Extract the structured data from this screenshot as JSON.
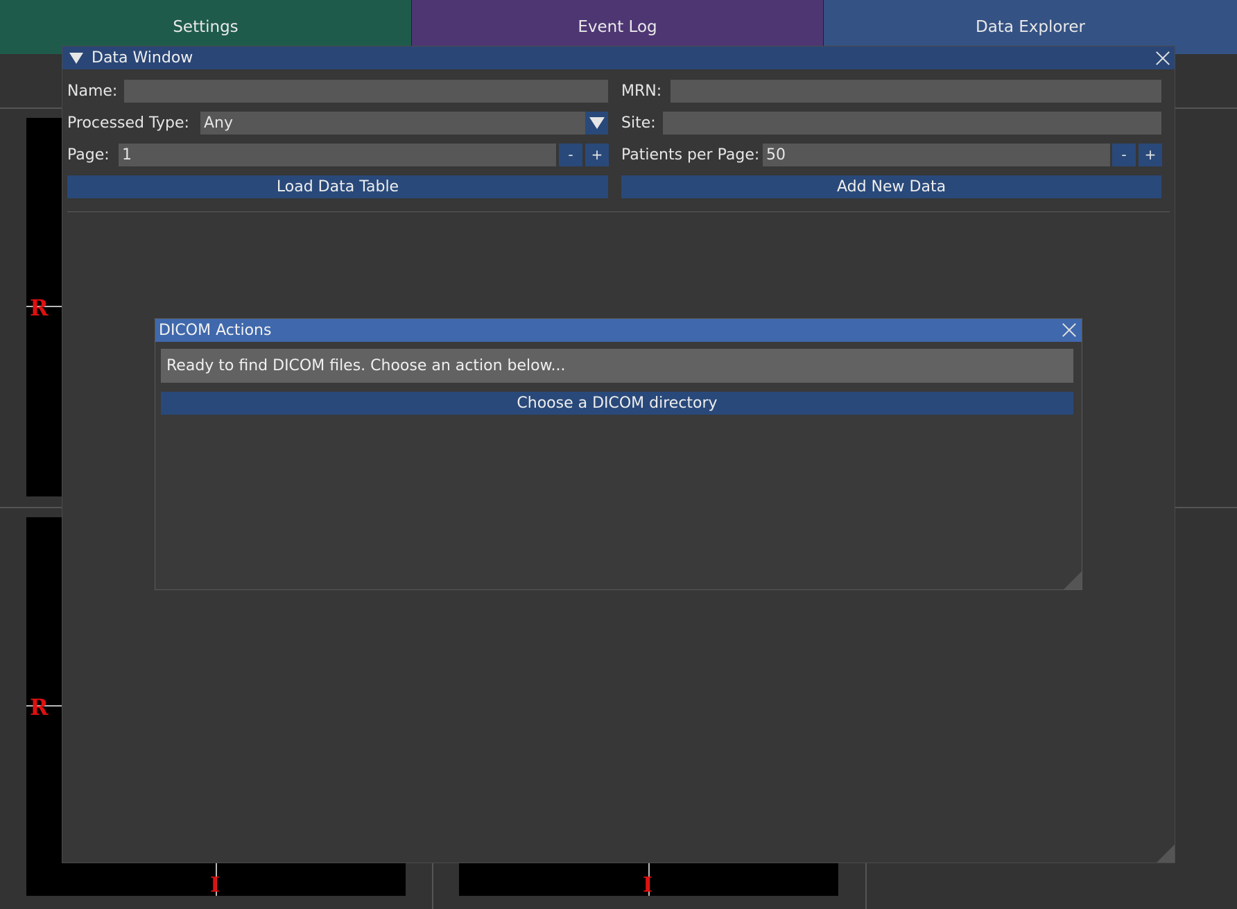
{
  "tabs": [
    {
      "label": "Settings",
      "color": "#1f5b4b"
    },
    {
      "label": "Event Log",
      "color": "#4e3673"
    },
    {
      "label": "Data Explorer",
      "color": "#345283"
    }
  ],
  "viewers": {
    "orientation_left": "R",
    "orientation_bottom": "I"
  },
  "data_window": {
    "title": "Data Window",
    "name_label": "Name:",
    "name_value": "",
    "mrn_label": "MRN:",
    "mrn_value": "",
    "processed_type_label": "Processed Type:",
    "processed_type_value": "Any",
    "site_label": "Site:",
    "site_value": "",
    "page_label": "Page:",
    "page_value": "1",
    "patients_per_page_label": "Patients per Page:",
    "patients_per_page_value": "50",
    "minus_label": "-",
    "plus_label": "+",
    "load_button": "Load Data Table",
    "add_button": "Add New Data"
  },
  "dicom_dialog": {
    "title": "DICOM Actions",
    "status": "Ready to find DICOM files. Choose an action below...",
    "choose_button": "Choose a DICOM directory"
  },
  "colors": {
    "accent_button": "#29497a",
    "dialog_title": "#4068ac",
    "window_title": "#2a4676",
    "orientation_marker": "#e01010"
  }
}
